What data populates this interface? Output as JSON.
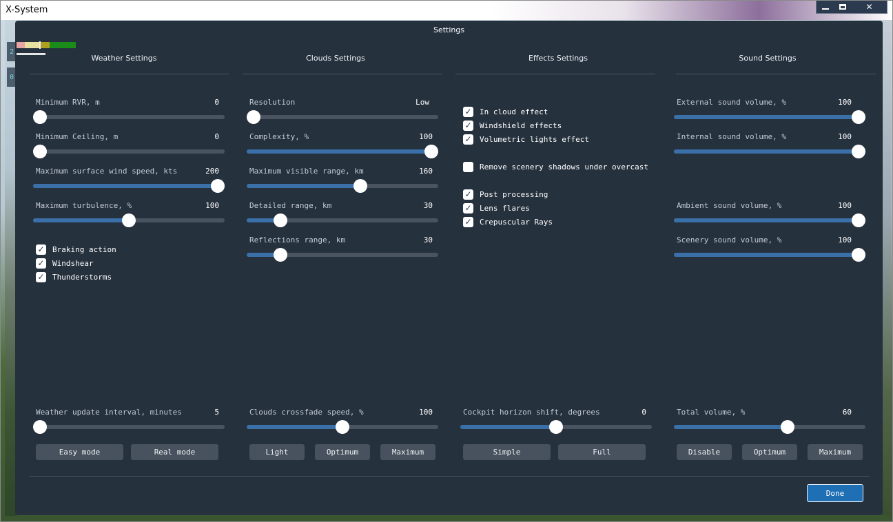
{
  "window": {
    "title": "X-System",
    "side_tags": [
      "2",
      "0"
    ]
  },
  "dialog": {
    "title": "Settings",
    "status_colors": [
      "#e8a3a3",
      "#e8e0a0",
      "#b0a020",
      "#1a8c1a"
    ]
  },
  "weather": {
    "title": "Weather Settings",
    "sliders": [
      {
        "label": "Minimum RVR, m",
        "value": "0",
        "fraction": 0.0
      },
      {
        "label": "Minimum Ceiling, m",
        "value": "0",
        "fraction": 0.0
      },
      {
        "label": "Maximum surface wind speed, kts",
        "value": "200",
        "fraction": 1.0
      },
      {
        "label": "Maximum turbulence, %",
        "value": "100",
        "fraction": 0.5
      }
    ],
    "checks": [
      {
        "label": "Braking action",
        "checked": true
      },
      {
        "label": "Windshear",
        "checked": true
      },
      {
        "label": "Thunderstorms",
        "checked": true
      }
    ],
    "bottom_slider": {
      "label": "Weather update interval, minutes",
      "value": "5",
      "fraction": 0.0
    },
    "buttons": [
      "Easy mode",
      "Real mode"
    ]
  },
  "clouds": {
    "title": "Clouds Settings",
    "sliders": [
      {
        "label": "Resolution",
        "value": "Low",
        "fraction": 0.0
      },
      {
        "label": "Complexity, %",
        "value": "100",
        "fraction": 1.0
      },
      {
        "label": "Maximum visible range, km",
        "value": "160",
        "fraction": 0.6
      },
      {
        "label": "Detailed range, km",
        "value": "30",
        "fraction": 0.15
      },
      {
        "label": "Reflections range, km",
        "value": "30",
        "fraction": 0.15
      }
    ],
    "bottom_slider": {
      "label": "Clouds crossfade speed, %",
      "value": "100",
      "fraction": 0.5
    },
    "buttons": [
      "Light",
      "Optimum",
      "Maximum"
    ]
  },
  "effects": {
    "title": "Effects Settings",
    "checks": [
      {
        "label": "In cloud effect",
        "checked": true
      },
      {
        "label": "Windshield effects",
        "checked": true
      },
      {
        "label": "Volumetric lights effect",
        "checked": true
      },
      {
        "label": "Remove scenery shadows under overcast",
        "checked": false
      },
      {
        "label": "Post processing",
        "checked": true
      },
      {
        "label": "Lens flares",
        "checked": true
      },
      {
        "label": "Crepuscular Rays",
        "checked": true
      }
    ],
    "bottom_slider": {
      "label": "Cockpit horizon shift, degrees",
      "value": "0",
      "fraction": 0.5
    },
    "buttons": [
      "Simple",
      "Full"
    ]
  },
  "sound": {
    "title": "Sound Settings",
    "sliders": [
      {
        "label": "External sound volume, %",
        "value": "100",
        "fraction": 1.0
      },
      {
        "label": "Internal sound volume, %",
        "value": "100",
        "fraction": 1.0
      },
      {
        "label": "Ambient sound volume, %",
        "value": "100",
        "fraction": 1.0
      },
      {
        "label": "Scenery sound volume, %",
        "value": "100",
        "fraction": 1.0
      }
    ],
    "bottom_slider": {
      "label": "Total volume, %",
      "value": "60",
      "fraction": 0.6
    },
    "buttons": [
      "Disable",
      "Optimum",
      "Maximum"
    ]
  },
  "footer": {
    "done_label": "Done"
  }
}
